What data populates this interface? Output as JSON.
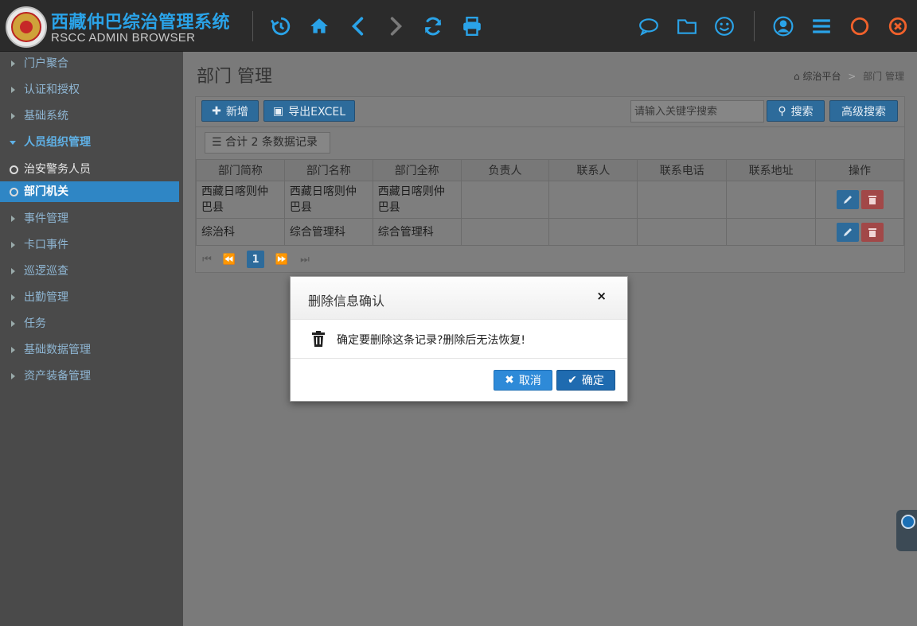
{
  "header": {
    "title": "西藏仲巴综治管理系统",
    "subtitle": "RSCC ADMIN BROWSER",
    "toolbar_icons": [
      "history-icon",
      "home-icon",
      "back-icon",
      "forward-icon",
      "refresh-icon",
      "print-icon",
      "chat-icon",
      "folder-icon",
      "smiley-icon",
      "user-icon",
      "menu-icon",
      "circle-icon",
      "close-icon"
    ],
    "accent_color": "#2aa3e8",
    "close_color": "#f0612b"
  },
  "sidebar": {
    "items": [
      {
        "label": "门户聚合"
      },
      {
        "label": "认证和授权"
      },
      {
        "label": "基础系统"
      },
      {
        "label": "人员组织管理"
      },
      {
        "label": "治安警务人员"
      },
      {
        "label": "部门机关"
      },
      {
        "label": "事件管理"
      },
      {
        "label": "卡口事件"
      },
      {
        "label": "巡逻巡查"
      },
      {
        "label": "出勤管理"
      },
      {
        "label": "任务"
      },
      {
        "label": "基础数据管理"
      },
      {
        "label": "资产装备管理"
      }
    ],
    "active_color": "#2f86c5"
  },
  "page": {
    "title": "部门 管理",
    "breadcrumb": {
      "root": "综治平台",
      "sep": ">",
      "current": "部门 管理"
    }
  },
  "toolbar": {
    "add_label": "新增",
    "export_label": "导出EXCEL",
    "search_placeholder": "请输入关键字搜索",
    "search_label": "搜索",
    "advanced_label": "高级搜索"
  },
  "summary": {
    "text": "合计 2 条数据记录"
  },
  "table": {
    "columns": [
      "部门简称",
      "部门名称",
      "部门全称",
      "负责人",
      "联系人",
      "联系电话",
      "联系地址",
      "操作"
    ],
    "rows": [
      [
        "西藏日喀则仲巴县",
        "西藏日喀则仲巴县",
        "西藏日喀则仲巴县",
        "",
        "",
        "",
        ""
      ],
      [
        "综治科",
        "综合管理科",
        "综合管理科",
        "",
        "",
        "",
        ""
      ]
    ]
  },
  "pager": {
    "current": "1"
  },
  "modal": {
    "title": "删除信息确认",
    "close": "×",
    "message": "确定要删除这条记录?删除后无法恢复!",
    "cancel_label": "取消",
    "ok_label": "确定"
  }
}
